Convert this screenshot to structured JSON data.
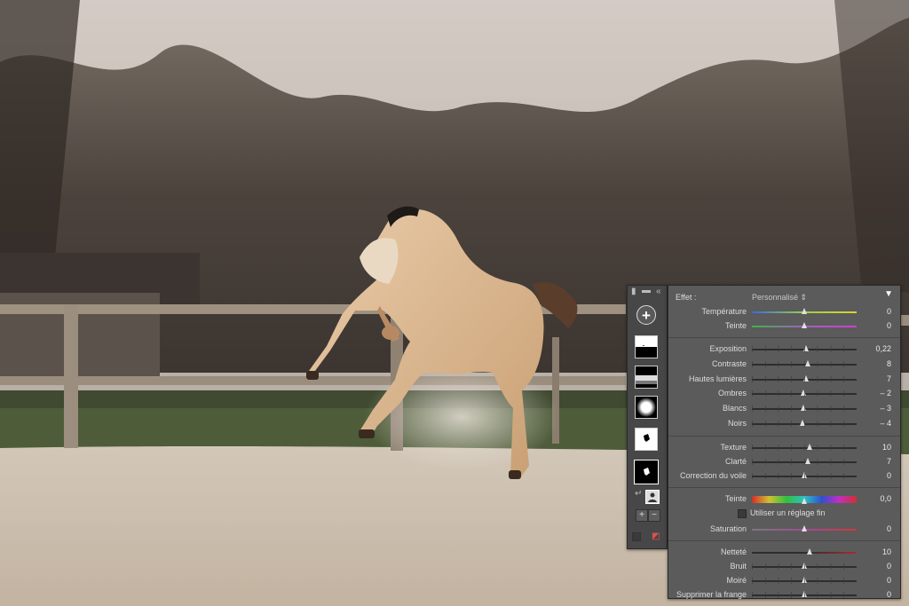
{
  "mask_panel": {
    "collapse_label": "«",
    "add_label": "+",
    "tools": [
      {
        "name": "Ciel"
      },
      {
        "name": "Arrière-plan"
      },
      {
        "name": "Radial"
      },
      {
        "name": "Sujet"
      },
      {
        "name": "Sujet (sélectionné)"
      }
    ],
    "add_small": "+",
    "remove_small": "−"
  },
  "adjust": {
    "effect_label": "Effet :",
    "effect_value": "Personnalisé ⇕",
    "menu_icon": "▼",
    "groups": [
      [
        {
          "label": "Température",
          "value": "0",
          "pos": 0.5,
          "grad": "temp"
        },
        {
          "label": "Teinte",
          "value": "0",
          "pos": 0.5,
          "grad": "tint"
        }
      ],
      [
        {
          "label": "Exposition",
          "value": "0,22",
          "pos": 0.52
        },
        {
          "label": "Contraste",
          "value": "8",
          "pos": 0.53
        },
        {
          "label": "Hautes lumières",
          "value": "7",
          "pos": 0.52
        },
        {
          "label": "Ombres",
          "value": "– 2",
          "pos": 0.49
        },
        {
          "label": "Blancs",
          "value": "– 3",
          "pos": 0.49
        },
        {
          "label": "Noirs",
          "value": "– 4",
          "pos": 0.48
        }
      ],
      [
        {
          "label": "Texture",
          "value": "10",
          "pos": 0.55
        },
        {
          "label": "Clarté",
          "value": "7",
          "pos": 0.53
        },
        {
          "label": "Correction du voile",
          "value": "0",
          "pos": 0.5
        }
      ],
      [
        {
          "label": "Teinte",
          "value": "0,0",
          "pos": 0.5,
          "grad": "hue"
        },
        {
          "check_label": "Utiliser un réglage fin"
        },
        {
          "label": "Saturation",
          "value": "0",
          "pos": 0.5,
          "grad": "sat"
        }
      ],
      [
        {
          "label": "Netteté",
          "value": "10",
          "pos": 0.55,
          "grad": "sharp"
        },
        {
          "label": "Bruit",
          "value": "0",
          "pos": 0.5
        },
        {
          "label": "Moiré",
          "value": "0",
          "pos": 0.5
        },
        {
          "label": "Supprimer la frange",
          "value": "0",
          "pos": 0.5
        }
      ]
    ]
  }
}
